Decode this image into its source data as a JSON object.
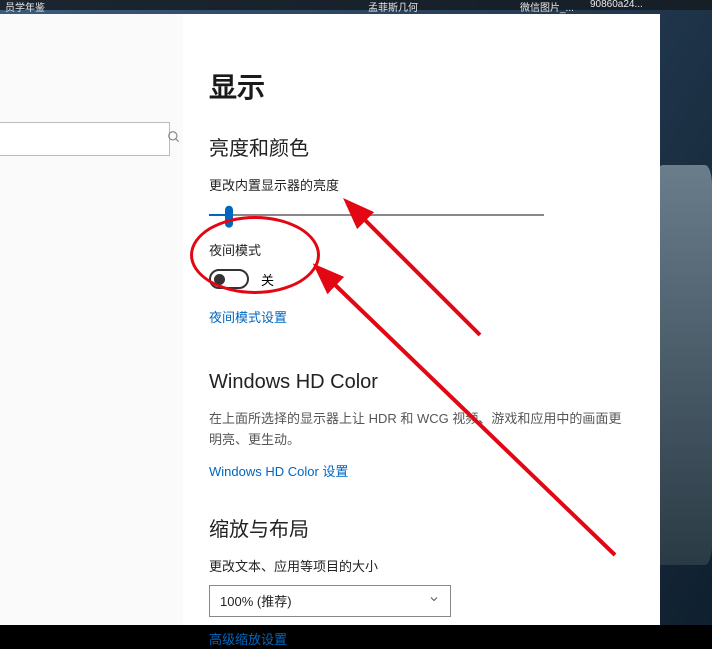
{
  "taskbar": {
    "item1": "员学年鉴",
    "item2": "孟菲斯几何",
    "item3": "微信图片_...",
    "item4": "90860a24..."
  },
  "window": {
    "minimize": "—",
    "maximize": "□",
    "close": "×"
  },
  "page": {
    "title": "显示"
  },
  "brightness": {
    "section": "亮度和颜色",
    "label": "更改内置显示器的亮度",
    "slider_value": 6
  },
  "nightlight": {
    "label": "夜间模式",
    "state": "关",
    "settings_link": "夜间模式设置"
  },
  "hdcolor": {
    "section": "Windows HD Color",
    "desc": "在上面所选择的显示器上让 HDR 和 WCG 视频、游戏和应用中的画面更明亮、更生动。",
    "link": "Windows HD Color 设置"
  },
  "scale": {
    "section": "缩放与布局",
    "label": "更改文本、应用等项目的大小",
    "dropdown_value": "100% (推荐)",
    "advanced_link": "高级缩放设置"
  },
  "search": {
    "placeholder": ""
  }
}
